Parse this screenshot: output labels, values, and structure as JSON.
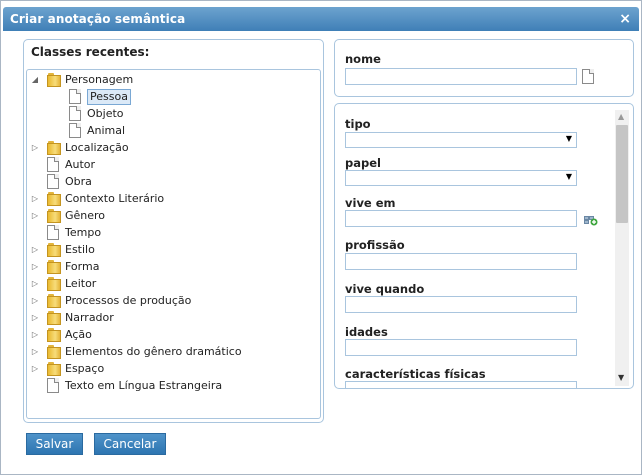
{
  "dialog": {
    "title": "Criar anotação semântica",
    "close_glyph": "×"
  },
  "left": {
    "heading": "Classes recentes:",
    "tree": [
      {
        "label": "Personagem",
        "icon": "folder",
        "arrow": "expanded",
        "level": 0
      },
      {
        "label": "Pessoa",
        "icon": "doc",
        "arrow": "none",
        "level": 1,
        "selected": true
      },
      {
        "label": "Objeto",
        "icon": "doc",
        "arrow": "none",
        "level": 1
      },
      {
        "label": "Animal",
        "icon": "doc",
        "arrow": "none",
        "level": 1
      },
      {
        "label": "Localização",
        "icon": "folder",
        "arrow": "collapsed",
        "level": 0
      },
      {
        "label": "Autor",
        "icon": "doc",
        "arrow": "none",
        "level": 0
      },
      {
        "label": "Obra",
        "icon": "doc",
        "arrow": "none",
        "level": 0
      },
      {
        "label": "Contexto Literário",
        "icon": "folder",
        "arrow": "collapsed",
        "level": 0
      },
      {
        "label": "Gênero",
        "icon": "folder",
        "arrow": "collapsed",
        "level": 0
      },
      {
        "label": "Tempo",
        "icon": "doc",
        "arrow": "none",
        "level": 0
      },
      {
        "label": "Estilo",
        "icon": "folder",
        "arrow": "collapsed",
        "level": 0
      },
      {
        "label": "Forma",
        "icon": "folder",
        "arrow": "collapsed",
        "level": 0
      },
      {
        "label": "Leitor",
        "icon": "folder",
        "arrow": "collapsed",
        "level": 0
      },
      {
        "label": "Processos de produção",
        "icon": "folder",
        "arrow": "collapsed",
        "level": 0
      },
      {
        "label": "Narrador",
        "icon": "folder",
        "arrow": "collapsed",
        "level": 0
      },
      {
        "label": "Ação",
        "icon": "folder",
        "arrow": "collapsed",
        "level": 0
      },
      {
        "label": "Elementos do gênero dramático",
        "icon": "folder",
        "arrow": "collapsed",
        "level": 0
      },
      {
        "label": "Espaço",
        "icon": "folder",
        "arrow": "collapsed",
        "level": 0
      },
      {
        "label": "Texto em Língua Estrangeira",
        "icon": "doc",
        "arrow": "none",
        "level": 0
      }
    ]
  },
  "right": {
    "nome_label": "nome",
    "nome_value": "",
    "fields": {
      "tipo": "tipo",
      "papel": "papel",
      "vive_em": "vive em",
      "profissao": "profissão",
      "vive_quando": "vive quando",
      "idades": "idades",
      "caracteristicas": "características físicas"
    },
    "tipo_value": "",
    "papel_value": "",
    "icons": {
      "nome_btn": "document-icon",
      "vive_em_btn": "add-link-icon",
      "select_arrow": "▼",
      "scroll_up": "▲",
      "scroll_down": "▼"
    }
  },
  "buttons": {
    "save": "Salvar",
    "cancel": "Cancelar"
  },
  "colors": {
    "titlebar": "#4a88c0",
    "panel_border": "#a9c5de",
    "button": "#3a82bd"
  }
}
